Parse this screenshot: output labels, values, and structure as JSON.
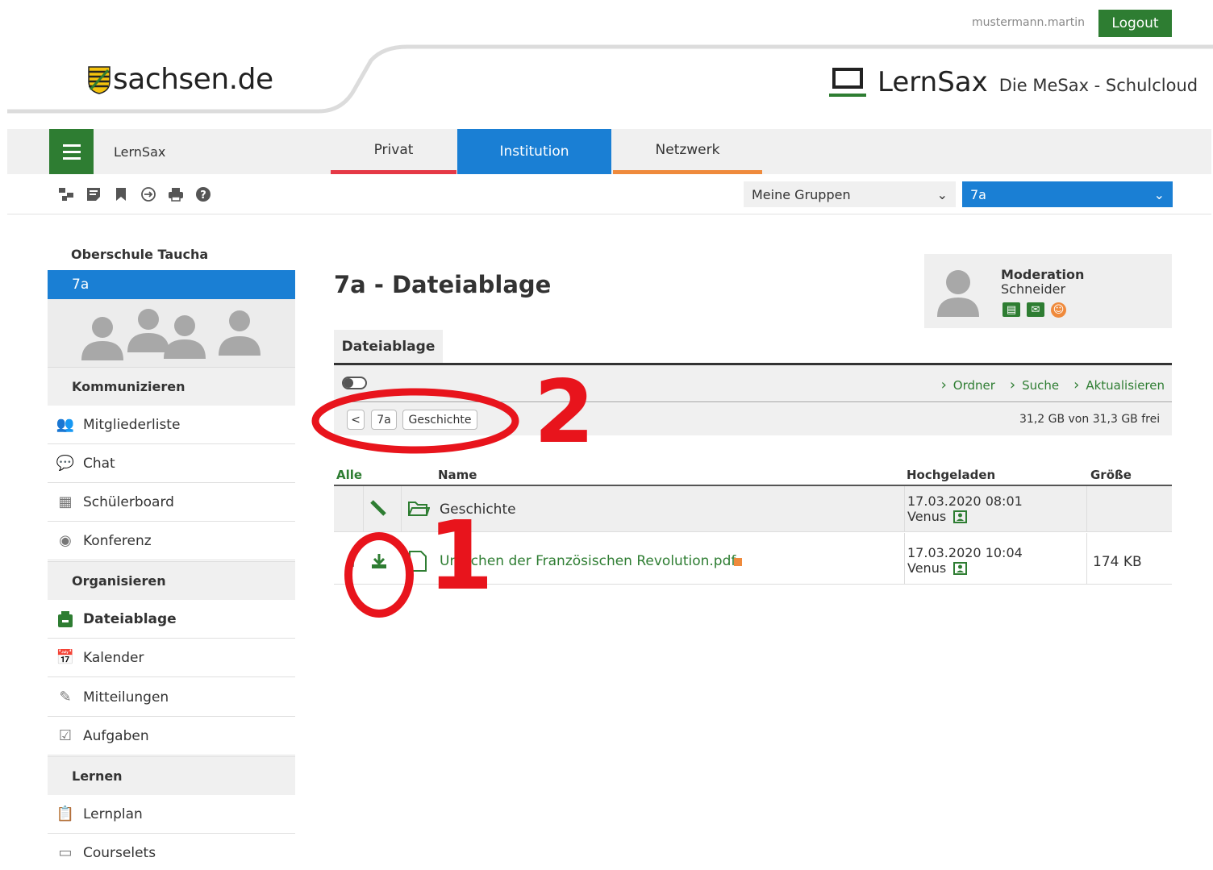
{
  "header": {
    "username": "mustermann.martin",
    "logout_label": "Logout",
    "sachsen_logo": "sachsen.de",
    "lernsax_title": "LernSax",
    "lernsax_subtitle": "Die MeSax - Schulcloud"
  },
  "nav": {
    "app_label": "LernSax",
    "tabs": [
      {
        "label": "Privat"
      },
      {
        "label": "Institution"
      },
      {
        "label": "Netzwerk"
      }
    ]
  },
  "toolbar": {
    "icons": [
      "sitemap-icon",
      "note-icon",
      "bookmark-icon",
      "logout-icon",
      "print-icon",
      "help-icon"
    ],
    "group_select": "Meine Gruppen",
    "class_select": "7a"
  },
  "sidebar": {
    "school": "Oberschule Taucha",
    "active_group": "7a",
    "sections": [
      {
        "title": "Kommunizieren",
        "items": [
          "Mitgliederliste",
          "Chat",
          "Schülerboard",
          "Konferenz"
        ]
      },
      {
        "title": "Organisieren",
        "items": [
          "Dateiablage",
          "Kalender",
          "Mitteilungen",
          "Aufgaben"
        ]
      },
      {
        "title": "Lernen",
        "items": [
          "Lernplan",
          "Courselets"
        ]
      }
    ]
  },
  "main": {
    "title": "7a - Dateiablage",
    "moderation_label": "Moderation",
    "moderator": "Schneider",
    "subtab": "Dateiablage",
    "actions": [
      "Ordner",
      "Suche",
      "Aktualisieren"
    ],
    "breadcrumb": [
      "<",
      "7a",
      "Geschichte"
    ],
    "quota": "31,2 GB von 31,3 GB frei",
    "table": {
      "headers": {
        "select": "Alle",
        "name": "Name",
        "uploaded": "Hochgeladen",
        "size": "Größe"
      },
      "rows": [
        {
          "name": "Geschichte",
          "date": "17.03.2020 08:01",
          "user": "Venus",
          "size": ""
        },
        {
          "name": "Ursachen der Französischen Revolution.pdf",
          "date": "17.03.2020 10:04",
          "user": "Venus",
          "size": "174 KB"
        }
      ]
    }
  },
  "annotations": {
    "one": "1",
    "two": "2"
  },
  "colors": {
    "green": "#2e7d32",
    "blue": "#1a7fd4",
    "red": "#e53946",
    "orange": "#ef8a3c",
    "annotation": "#e8141c"
  }
}
